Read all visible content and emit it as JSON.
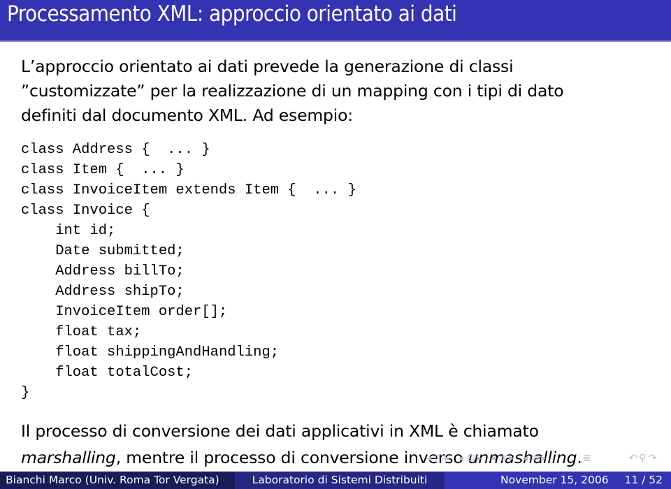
{
  "slide": {
    "title": "Processamento XML: approccio orientato ai dati",
    "intro_lines": [
      "L’approccio orientato ai dati prevede la generazione di classi",
      "”customizzate” per la realizzazione di un mapping con i tipi di dato",
      "definiti dal documento XML. Ad esempio:"
    ],
    "code_lines": [
      "class Address {  ... }",
      "class Item {  ... }",
      "class InvoiceItem extends Item {  ... }",
      "class Invoice {",
      "    int id;",
      "    Date submitted;",
      "    Address billTo;",
      "    Address shipTo;",
      "    InvoiceItem order[];",
      "    float tax;",
      "    float shippingAndHandling;",
      "    float totalCost;",
      "}"
    ],
    "conclusion": {
      "line1": "Il processo di conversione dei dati applicativi in XML è chiamato",
      "term1": "marshalling",
      "middle": ", mentre il processo di conversione inverso ",
      "term2": "unmashalling",
      "end": "."
    }
  },
  "navigation": {
    "icons": [
      "nav-frame-left",
      "nav-frame-right",
      "nav-subsection-left",
      "nav-subsection-right",
      "nav-section-left",
      "nav-section-right",
      "nav-align",
      "nav-search"
    ]
  },
  "footer": {
    "author": "Bianchi Marco  (Univ. Roma Tor Vergata)",
    "course": "Laboratorio di Sistemi Distribuiti",
    "date": "November 15, 2006",
    "page": "11 / 52"
  },
  "colors": {
    "header": "#3333b3",
    "footer_left": "#1b1b5a",
    "footer_middle": "#262684",
    "footer_right": "#3333b3"
  }
}
